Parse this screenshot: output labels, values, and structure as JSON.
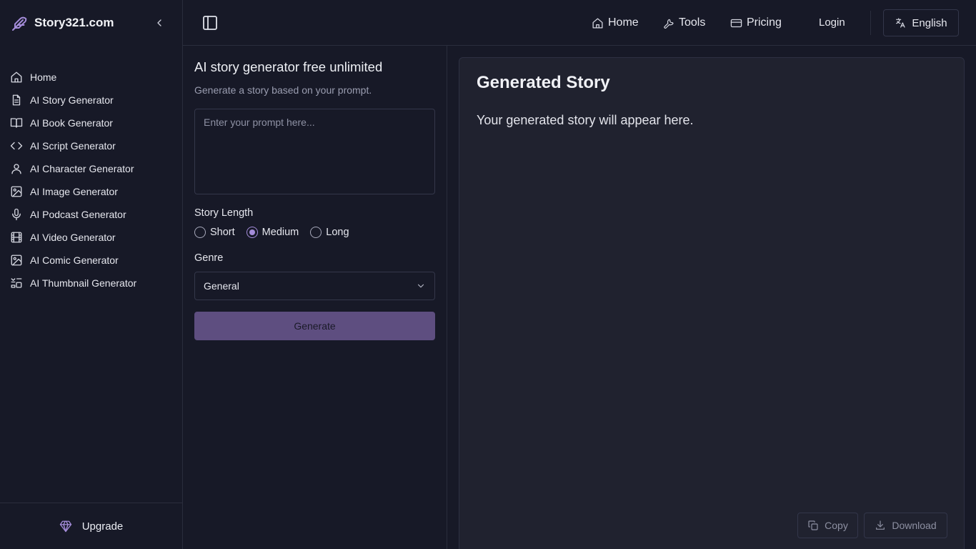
{
  "sidebar": {
    "brand": "Story321.com",
    "items": [
      {
        "label": "Home",
        "icon": "home-icon"
      },
      {
        "label": "AI Story Generator",
        "icon": "document-icon"
      },
      {
        "label": "AI Book Generator",
        "icon": "book-icon"
      },
      {
        "label": "AI Script Generator",
        "icon": "code-icon"
      },
      {
        "label": "AI Character Generator",
        "icon": "user-icon"
      },
      {
        "label": "AI Image Generator",
        "icon": "image-icon"
      },
      {
        "label": "AI Podcast Generator",
        "icon": "microphone-icon"
      },
      {
        "label": "AI Video Generator",
        "icon": "film-icon"
      },
      {
        "label": "AI Comic Generator",
        "icon": "image-icon"
      },
      {
        "label": "AI Thumbnail Generator",
        "icon": "thumbnail-icon"
      }
    ],
    "upgrade_label": "Upgrade"
  },
  "header": {
    "home": "Home",
    "tools": "Tools",
    "pricing": "Pricing",
    "login": "Login",
    "language": "English"
  },
  "form": {
    "title": "AI story generator free unlimited",
    "subtitle": "Generate a story based on your prompt.",
    "prompt_placeholder": "Enter your prompt here...",
    "prompt_value": "",
    "length_label": "Story Length",
    "length_options": [
      "Short",
      "Medium",
      "Long"
    ],
    "length_selected": "Medium",
    "genre_label": "Genre",
    "genre_value": "General",
    "generate_label": "Generate"
  },
  "output": {
    "title": "Generated Story",
    "placeholder": "Your generated story will appear here.",
    "copy_label": "Copy",
    "download_label": "Download"
  },
  "colors": {
    "background": "#171927",
    "panel": "#20222f",
    "accent": "#a48cd9",
    "generate_button": "#5e4e80"
  }
}
